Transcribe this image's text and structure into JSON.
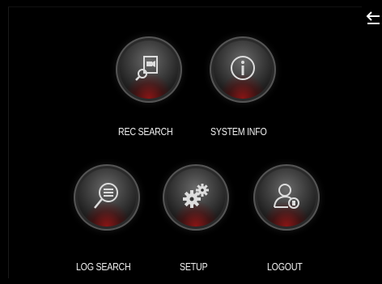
{
  "menu": {
    "rec_search": "REC SEARCH",
    "system_info": "SYSTEM INFO",
    "log_search": "LOG SEARCH",
    "setup": "SETUP",
    "logout": "LOGOUT"
  },
  "icons": {
    "back": "back-arrow-icon",
    "rec_search": "video-document-search-icon",
    "system_info": "info-icon",
    "log_search": "log-magnifier-icon",
    "setup": "gears-icon",
    "logout": "user-logout-icon"
  },
  "colors": {
    "background": "#000000",
    "accent_glow": "#a01414",
    "text": "#f0f0f0"
  }
}
